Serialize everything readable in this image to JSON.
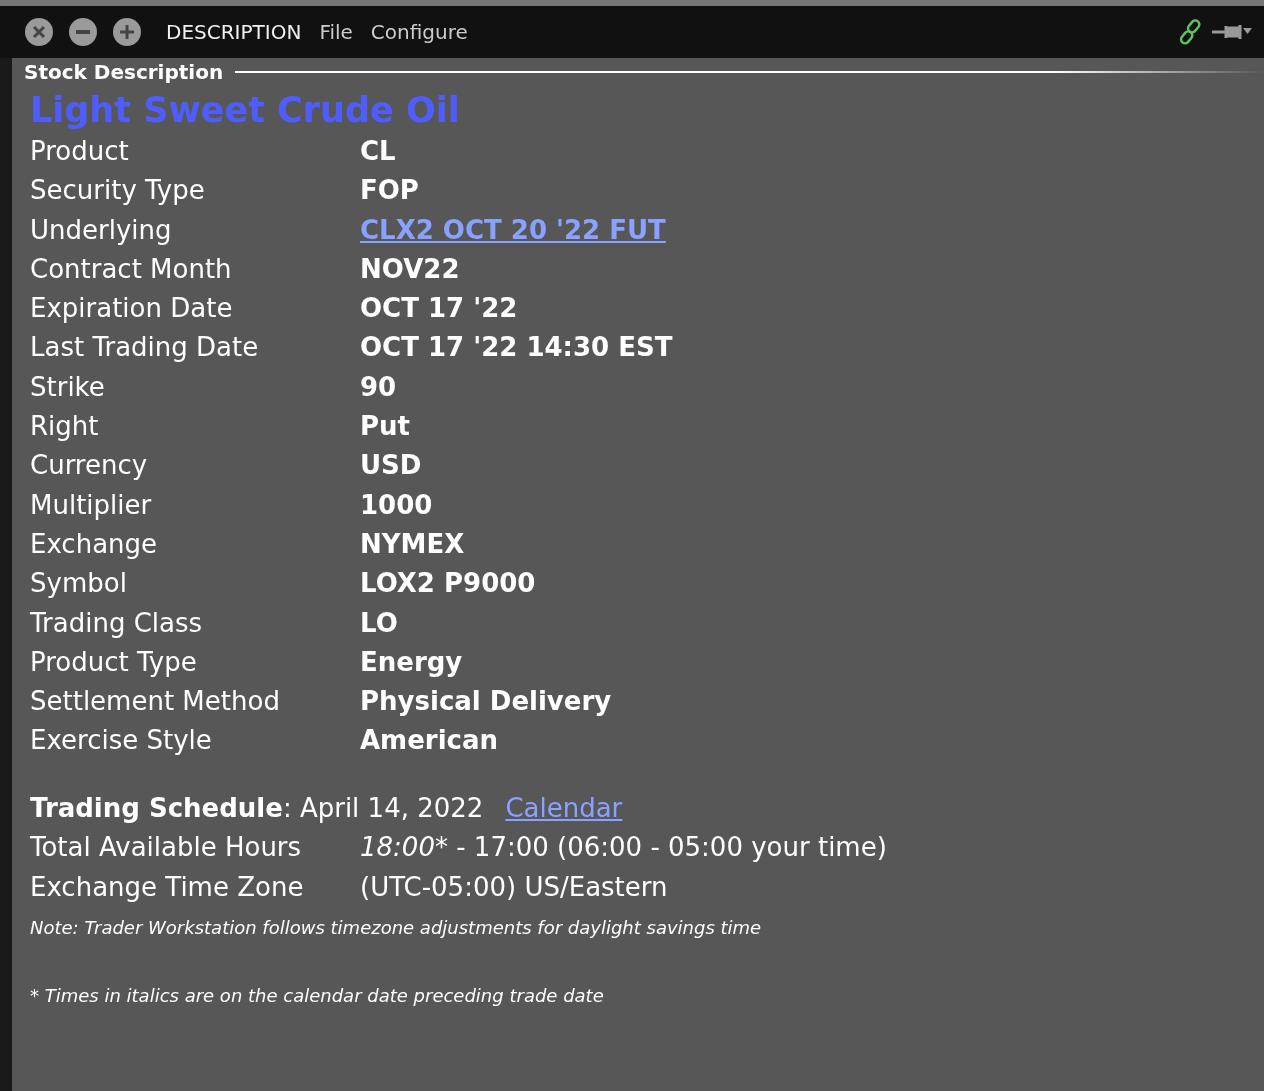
{
  "window": {
    "title": "DESCRIPTION",
    "menu": [
      "File",
      "Configure"
    ]
  },
  "section": {
    "title": "Stock Description"
  },
  "heading": "Light Sweet Crude Oil",
  "fields": [
    {
      "label": "Product",
      "value": "CL",
      "kind": "text"
    },
    {
      "label": "Security Type",
      "value": "FOP",
      "kind": "text"
    },
    {
      "label": "Underlying",
      "value": "CLX2 OCT 20 '22 FUT",
      "kind": "link"
    },
    {
      "label": "Contract Month",
      "value": "NOV22",
      "kind": "text"
    },
    {
      "label": "Expiration Date",
      "value": "OCT 17 '22",
      "kind": "text"
    },
    {
      "label": "Last Trading Date",
      "value": "OCT 17 '22 14:30 EST",
      "kind": "text"
    },
    {
      "label": "Strike",
      "value": "90",
      "kind": "text"
    },
    {
      "label": "Right",
      "value": "Put",
      "kind": "text"
    },
    {
      "label": "Currency",
      "value": "USD",
      "kind": "text"
    },
    {
      "label": "Multiplier",
      "value": "1000",
      "kind": "text"
    },
    {
      "label": "Exchange",
      "value": "NYMEX",
      "kind": "text"
    },
    {
      "label": "Symbol",
      "value": "LOX2 P9000",
      "kind": "text"
    },
    {
      "label": "Trading Class",
      "value": "LO",
      "kind": "text"
    },
    {
      "label": "Product Type",
      "value": "Energy",
      "kind": "text"
    },
    {
      "label": "Settlement Method",
      "value": "Physical Delivery",
      "kind": "text"
    },
    {
      "label": "Exercise Style",
      "value": "American",
      "kind": "text"
    }
  ],
  "schedule": {
    "text": "**Trading Schedule**: April 14, 2022",
    "link": "Calendar",
    "hours_label": "Total Available Hours",
    "hours_start": "18:00",
    "hours_rest": "* - 17:00 (06:00 - 05:00 your time)",
    "zone_label": "Exchange Time Zone",
    "zone_value": "(UTC-05:00) US/Eastern",
    "note": "Note: Trader Workstation follows timezone adjustments for daylight savings time",
    "footnote": "* Times in italics are on the calendar date preceding trade date"
  }
}
